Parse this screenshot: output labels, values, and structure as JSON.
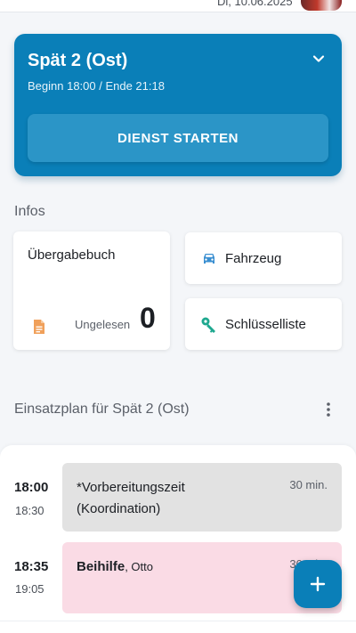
{
  "topbar": {
    "date": "Di, 10.06.2025"
  },
  "shift": {
    "title": "Spät 2 (Ost)",
    "subtitle": "Beginn 18:00 / Ende 21:18",
    "start_button": "DIENST STARTEN",
    "accent_color": "#0a7fb8"
  },
  "infos": {
    "title": "Infos",
    "uebergabebuch": {
      "title": "Übergabebuch",
      "unread_label": "Ungelesen",
      "unread_count": "0",
      "icon": "document-icon"
    },
    "fahrzeug": {
      "label": "Fahrzeug",
      "icon": "car-icon"
    },
    "schluessel": {
      "label": "Schlüsselliste",
      "icon": "key-icon"
    }
  },
  "plan": {
    "title": "Einsatzplan für Spät 2 (Ost)",
    "entries": [
      {
        "start": "18:00",
        "end": "18:30",
        "title": "*Vorbereitungszeit (Koordination)",
        "duration": "30 min."
      },
      {
        "start": "18:35",
        "end": "19:05",
        "title": "Beihilfe",
        "person": ", Otto",
        "duration": "30 min."
      }
    ]
  }
}
